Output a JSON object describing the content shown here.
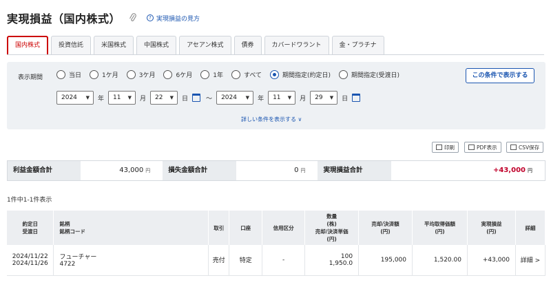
{
  "header": {
    "title": "実現損益（国内株式）",
    "help_label": "実現損益の見方"
  },
  "tabs": [
    "国内株式",
    "投資信託",
    "米国株式",
    "中国株式",
    "アセアン株式",
    "債券",
    "カバードワラント",
    "金・プラチナ"
  ],
  "conditions": {
    "period_label": "表示期間",
    "options": [
      "当日",
      "1ケ月",
      "3ケ月",
      "6ケ月",
      "1年",
      "すべて",
      "期間指定(約定日)",
      "期間指定(受渡日)"
    ],
    "selected_option": "期間指定(約定日)",
    "from": {
      "year": "2024",
      "month": "11",
      "day": "22"
    },
    "to": {
      "year": "2024",
      "month": "11",
      "day": "29"
    },
    "units": {
      "year": "年",
      "month": "月",
      "day": "日",
      "tilde": "～"
    },
    "search_button": "この条件で表示する",
    "more_label": "詳しい条件を表示する ∨"
  },
  "actions": {
    "print": "印刷",
    "pdf": "PDF表示",
    "csv": "CSV保存"
  },
  "summary": {
    "profit_label": "利益金額合計",
    "profit_value": "43,000",
    "loss_label": "損失金額合計",
    "loss_value": "0",
    "total_label": "実現損益合計",
    "total_value": "+43,000",
    "unit": "円"
  },
  "count_text": "1件中1-1件表示",
  "table": {
    "headers": {
      "date1": "約定日",
      "date2": "受渡日",
      "name1": "銘柄",
      "name2": "銘柄コード",
      "trade": "取引",
      "account": "口座",
      "credit": "信用区分",
      "qty1": "数量",
      "qty2": "(株)",
      "qty3": "売却/決済単価",
      "qty4": "(円)",
      "sale1": "売却/決済額",
      "sale2": "(円)",
      "cost1": "平均取得価額",
      "cost2": "(円)",
      "pl1": "実現損益",
      "pl2": "(円)",
      "detail": "詳細"
    },
    "rows": [
      {
        "trade_date": "2024/11/22",
        "settle_date": "2024/11/26",
        "name": "フューチャー",
        "code": "4722",
        "trade": "売付",
        "account": "特定",
        "credit": "-",
        "qty": "100",
        "price": "1,950.0",
        "sale": "195,000",
        "cost": "1,520.00",
        "pl": "+43,000",
        "detail": "詳細 >"
      }
    ]
  }
}
